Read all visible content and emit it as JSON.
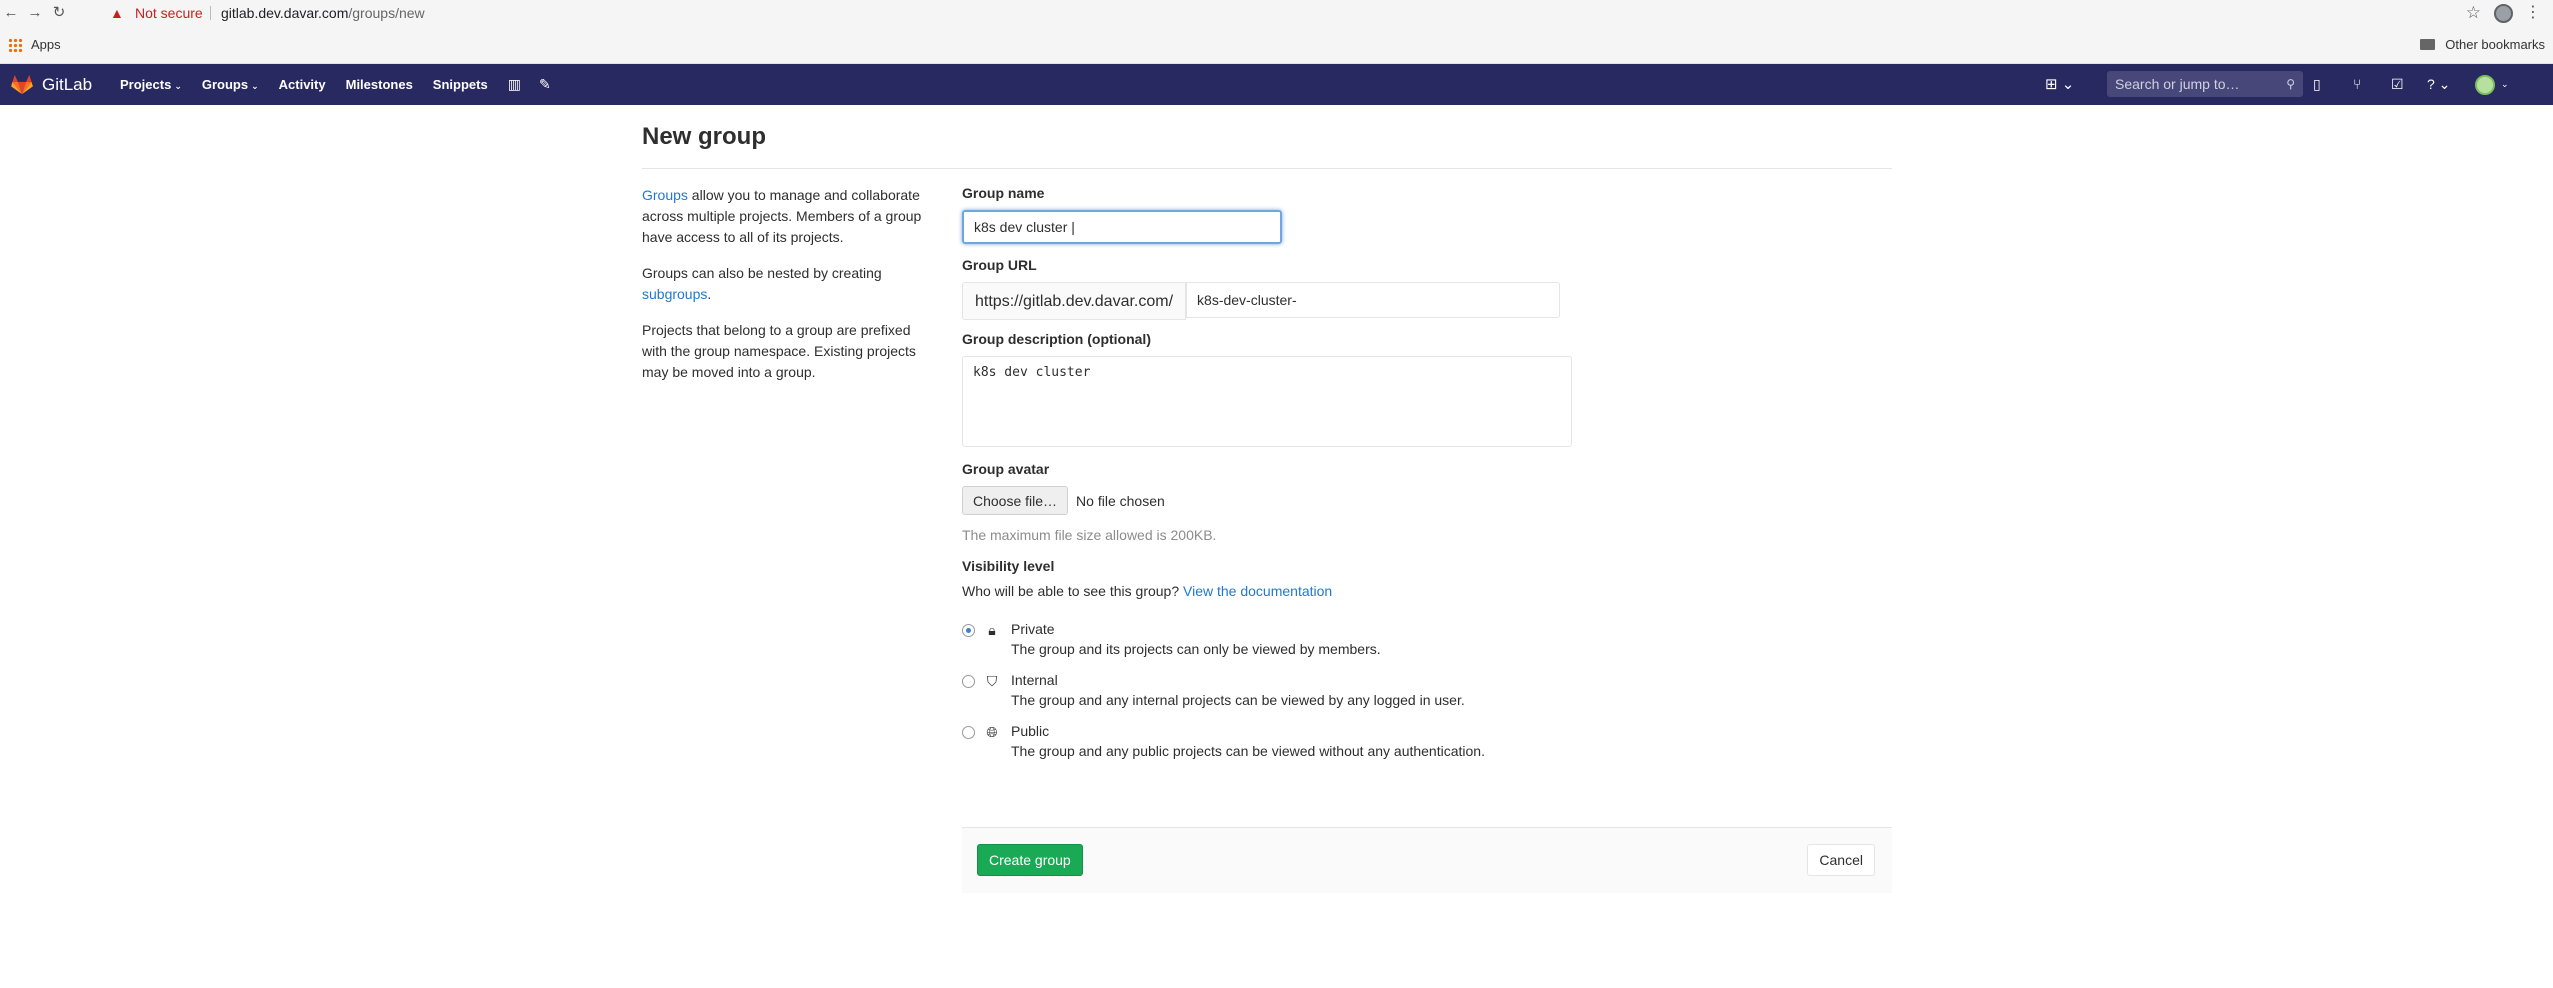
{
  "browser": {
    "not_secure": "Not secure",
    "url_host": "gitlab.dev.davar.com",
    "url_path": "/groups/new",
    "apps_label": "Apps",
    "other_bookmarks": "Other bookmarks"
  },
  "navbar": {
    "brand": "GitLab",
    "items": [
      "Projects",
      "Groups",
      "Activity",
      "Milestones",
      "Snippets"
    ],
    "search_placeholder": "Search or jump to…"
  },
  "page": {
    "title": "New group"
  },
  "sidebar": {
    "p1_link": "Groups",
    "p1_text": " allow you to manage and collaborate across multiple projects. Members of a group have access to all of its projects.",
    "p2_text": "Groups can also be nested by creating ",
    "p2_link": "subgroups",
    "p2_end": ".",
    "p3_text": "Projects that belong to a group are prefixed with the group namespace. Existing projects may be moved into a group."
  },
  "form": {
    "name_label": "Group name",
    "name_value": "k8s dev cluster |",
    "url_label": "Group URL",
    "url_prefix": "https://gitlab.dev.davar.com/",
    "url_value": "k8s-dev-cluster-",
    "desc_label": "Group description (optional)",
    "desc_value": "k8s dev cluster",
    "avatar_label": "Group avatar",
    "choose_file": "Choose file…",
    "no_file": "No file chosen",
    "max_size": "The maximum file size allowed is 200KB.",
    "visibility_label": "Visibility level",
    "visibility_question": "Who will be able to see this group?",
    "visibility_doc_link": "View the documentation",
    "visibility_options": [
      {
        "label": "Private",
        "desc": "The group and its projects can only be viewed by members.",
        "icon": "lock-icon",
        "checked": true
      },
      {
        "label": "Internal",
        "desc": "The group and any internal projects can be viewed by any logged in user.",
        "icon": "shield-icon",
        "checked": false
      },
      {
        "label": "Public",
        "desc": "The group and any public projects can be viewed without any authentication.",
        "icon": "globe-icon",
        "checked": false
      }
    ],
    "create_button": "Create group",
    "cancel_button": "Cancel"
  },
  "colors": {
    "navbar": "#292961",
    "link": "#1f78d1",
    "create_button": "#1aaa55"
  }
}
